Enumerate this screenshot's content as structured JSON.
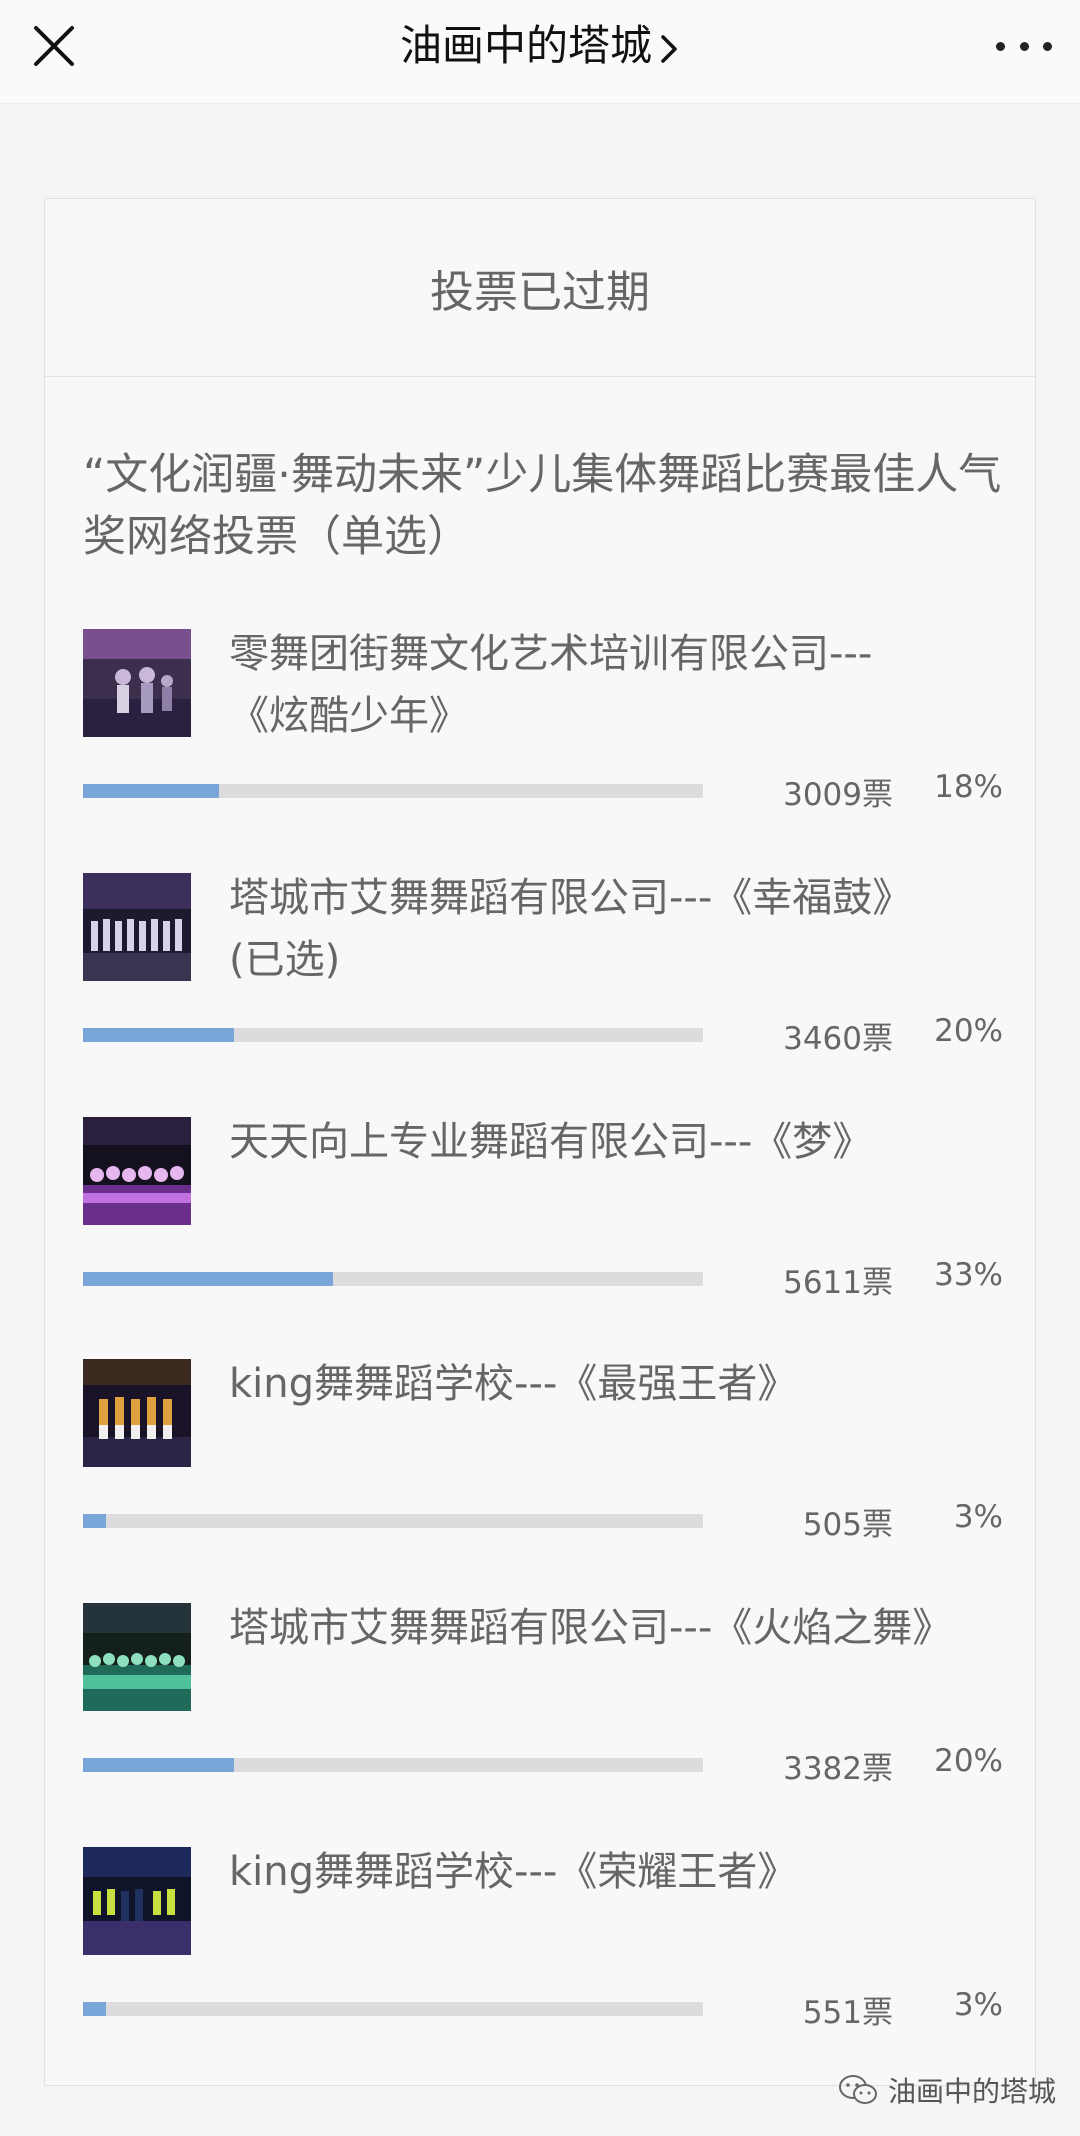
{
  "header": {
    "title": "油画中的塔城",
    "close_icon": "close-icon",
    "more_icon": "more-dots-icon"
  },
  "poll": {
    "status": "投票已过期",
    "question": "“文化润疆·舞动未来”少儿集体舞蹈比赛最佳人气奖网络投票（单选）",
    "options": [
      {
        "label": "零舞团街舞文化艺术培训有限公司---《炫酷少年》",
        "votes": "3009票",
        "percent": "18%",
        "fill": 0.18
      },
      {
        "label": "塔城市艾舞舞蹈有限公司---《幸福鼓》(已选)",
        "votes": "3460票",
        "percent": "20%",
        "fill": 0.2
      },
      {
        "label": "天天向上专业舞蹈有限公司---《梦》",
        "votes": "5611票",
        "percent": "33%",
        "fill": 0.33
      },
      {
        "label": "king舞舞蹈学校---《最强王者》",
        "votes": "505票",
        "percent": "3%",
        "fill": 0.03
      },
      {
        "label": "塔城市艾舞舞蹈有限公司---《火焰之舞》",
        "votes": "3382票",
        "percent": "20%",
        "fill": 0.2
      },
      {
        "label": "king舞舞蹈学校---《荣耀王者》",
        "votes": "551票",
        "percent": "3%",
        "fill": 0.03
      }
    ]
  },
  "watermark": {
    "text": "油画中的塔城",
    "icon": "wechat-icon"
  },
  "colors": {
    "bar_fill": "#7aa5d8",
    "bar_track": "#dcdcdc"
  }
}
